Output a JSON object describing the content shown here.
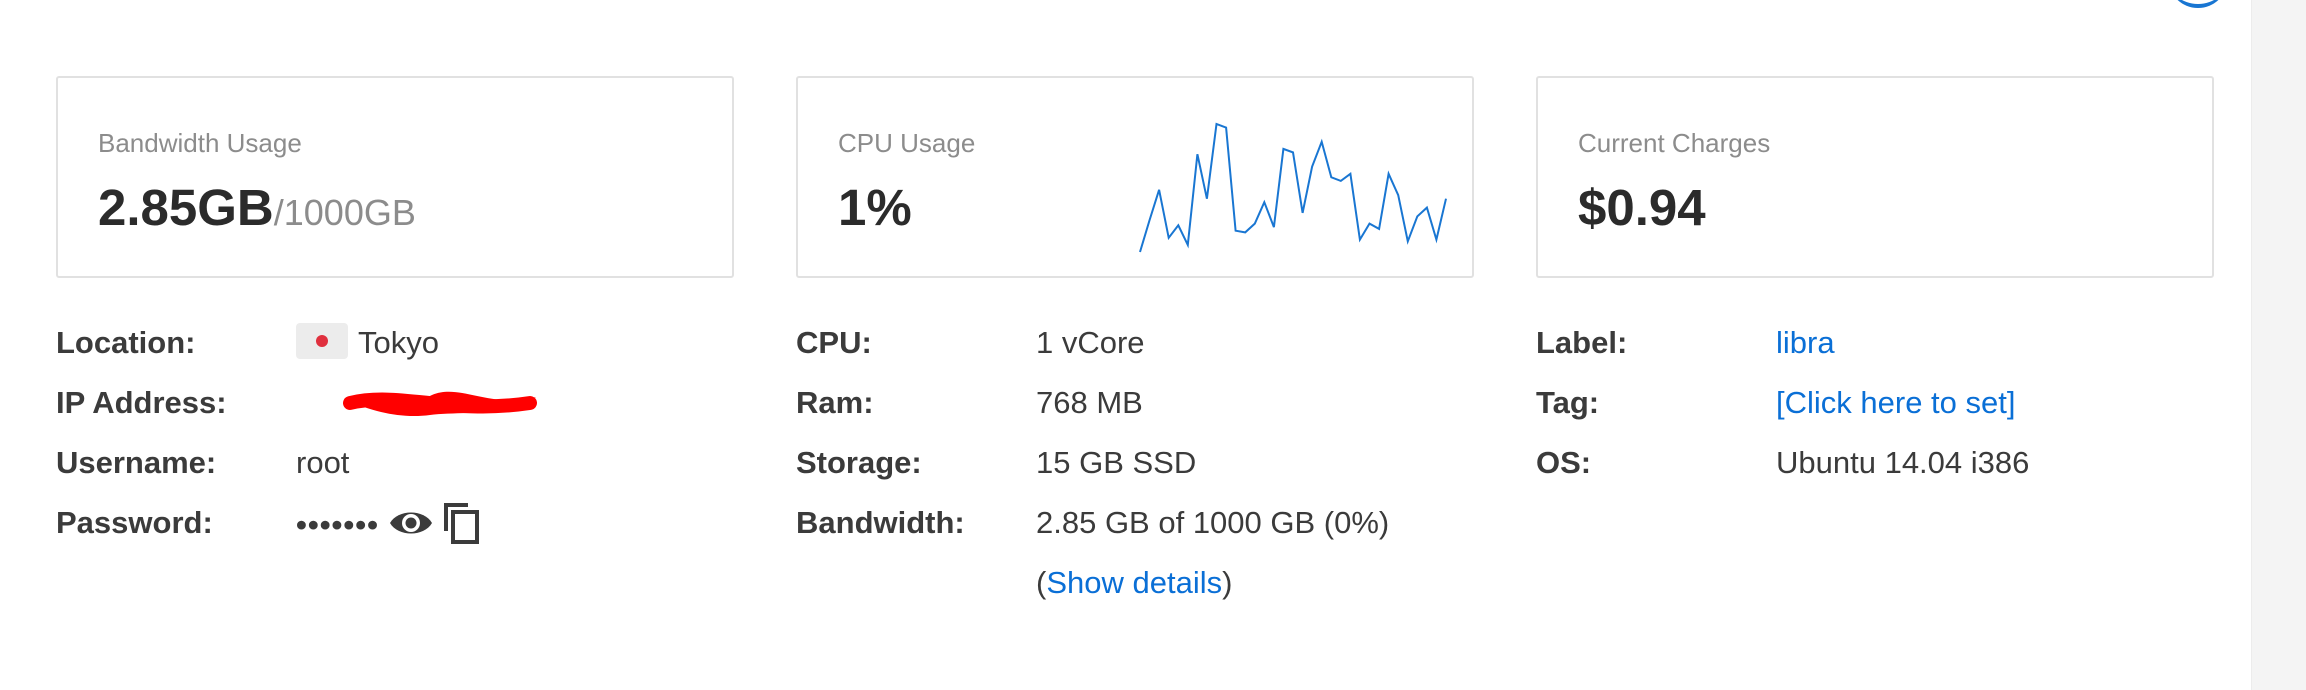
{
  "cards": {
    "bandwidth": {
      "title": "Bandwidth Usage",
      "value": "2.85GB",
      "sub": "/1000GB"
    },
    "cpu": {
      "title": "CPU Usage",
      "value": "1%",
      "sparkline_color": "#1976d2",
      "sparkline_values": [
        0,
        18,
        35,
        8,
        15,
        4,
        55,
        30,
        72,
        70,
        12,
        11,
        16,
        28,
        14,
        58,
        56,
        22,
        48,
        62,
        42,
        40,
        44,
        7,
        16,
        13,
        44,
        32,
        6,
        20,
        25,
        7,
        30
      ]
    },
    "charges": {
      "title": "Current Charges",
      "value": "$0.94"
    }
  },
  "details": {
    "col1": {
      "location_label": "Location:",
      "location_flag_icon": "japan-flag-icon",
      "location_value": "Tokyo",
      "ip_label": "IP Address:",
      "username_label": "Username:",
      "username_value": "root",
      "password_label": "Password:",
      "password_value": "•••••••",
      "eye_icon": "eye-icon",
      "copy_icon": "copy-icon"
    },
    "col2": {
      "cpu_label": "CPU:",
      "cpu_value": "1 vCore",
      "ram_label": "Ram:",
      "ram_value": "768 MB",
      "storage_label": "Storage:",
      "storage_value": "15 GB SSD",
      "bandwidth_label": "Bandwidth:",
      "bandwidth_value": "2.85 GB of 1000 GB (0%)",
      "details_open": "(",
      "details_link": "Show details",
      "details_close": ")"
    },
    "col3": {
      "label_label": "Label:",
      "label_value": "libra",
      "tag_label": "Tag:",
      "tag_value": "[Click here to set]",
      "os_label": "OS:",
      "os_value": "Ubuntu 14.04 i386"
    }
  },
  "colors": {
    "link": "#0a6fd6",
    "accent": "#1976d2",
    "redaction": "#ff0000"
  }
}
